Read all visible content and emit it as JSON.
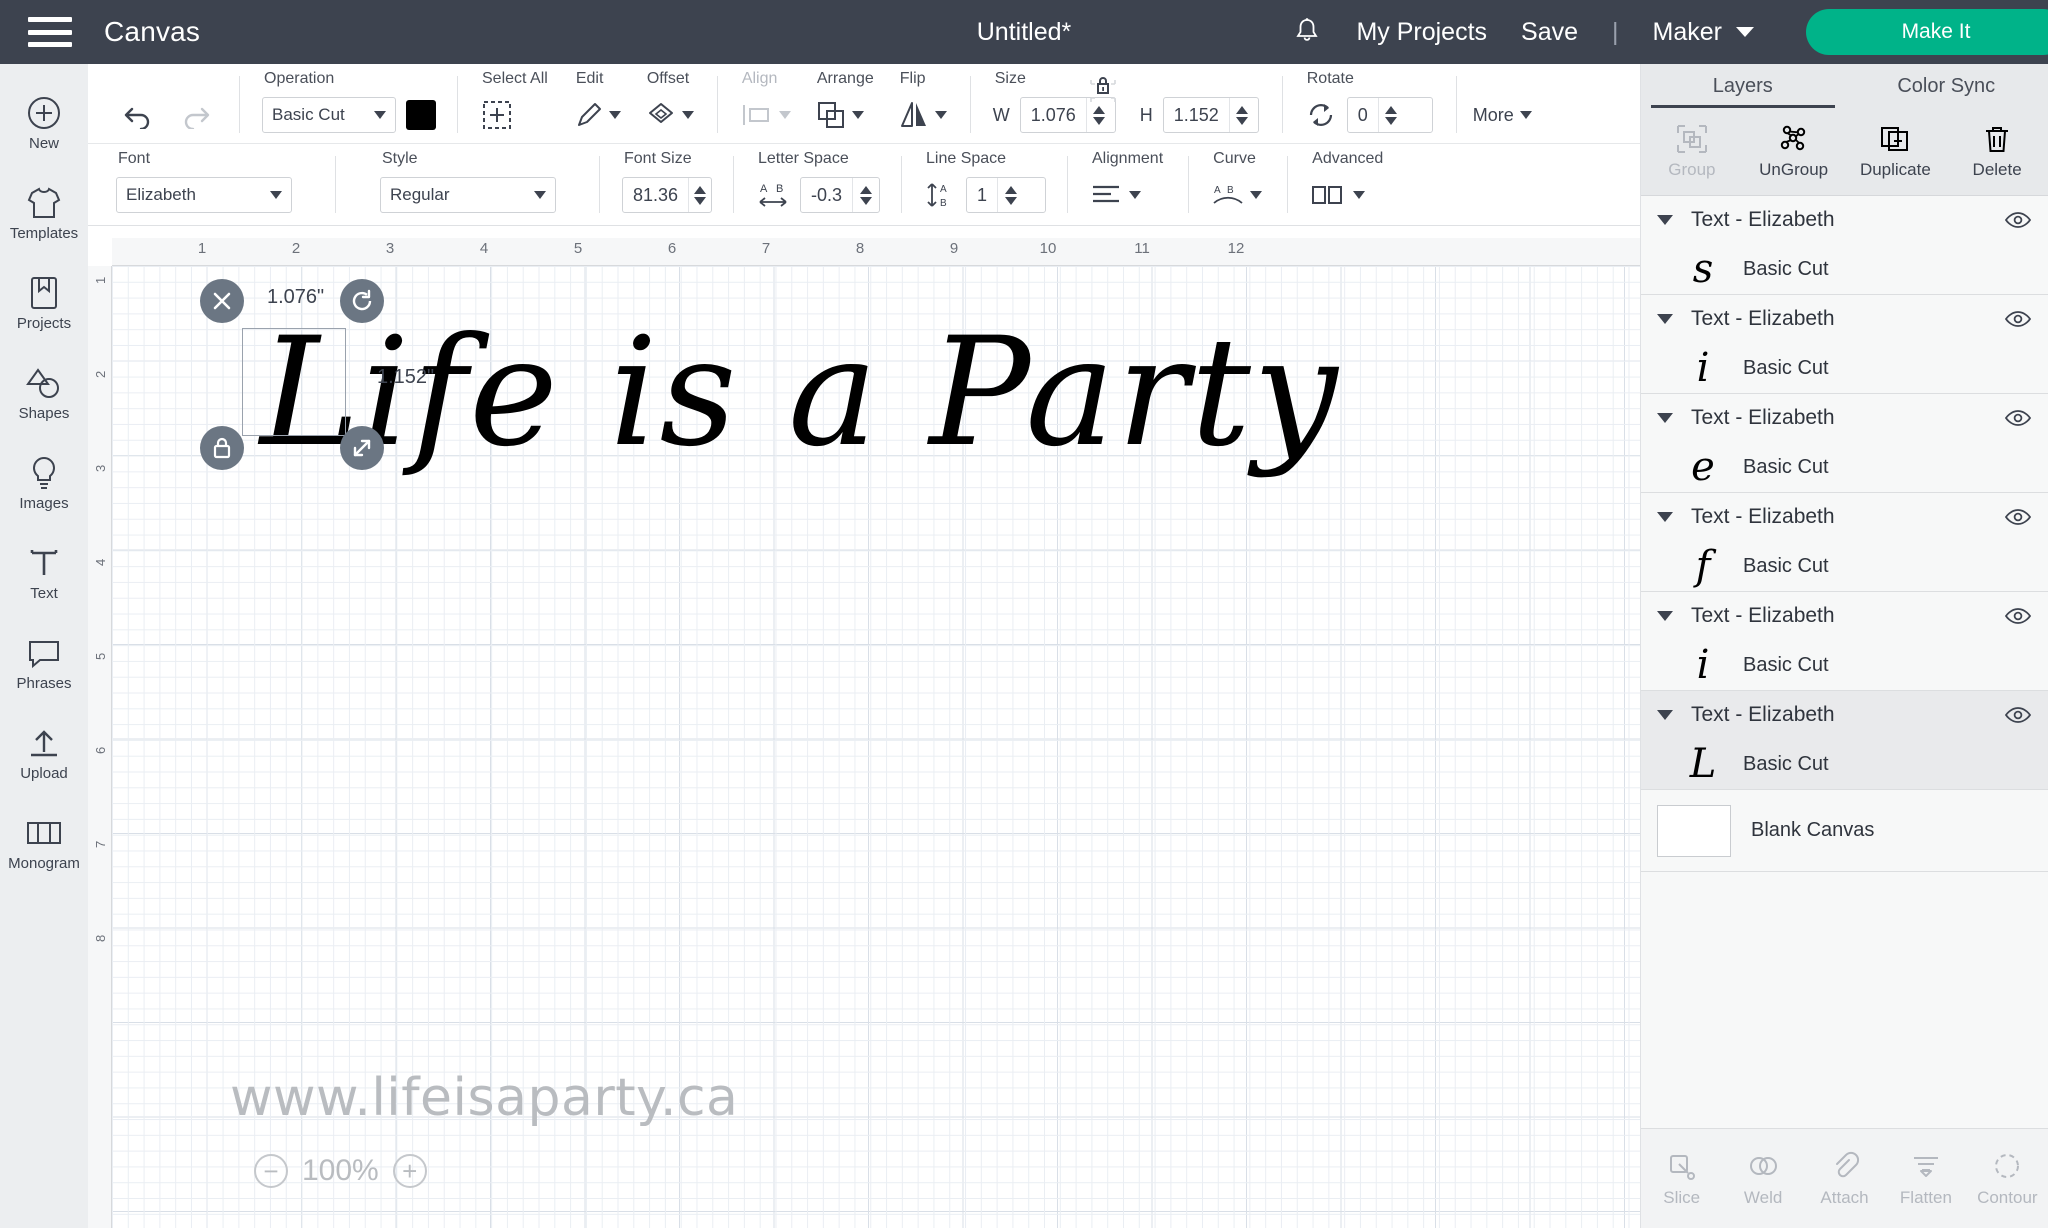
{
  "topbar": {
    "menu_icon": "hamburger-icon",
    "canvas_label": "Canvas",
    "title": "Untitled*",
    "bell_icon": "notification-bell-icon",
    "my_projects": "My Projects",
    "save": "Save",
    "separator": "|",
    "machine": "Maker",
    "make_it": "Make It",
    "accent_green": "#00b389",
    "bar_bg": "#3d434f"
  },
  "left_rail": [
    {
      "label": "New",
      "icon": "plus-circle-icon"
    },
    {
      "label": "Templates",
      "icon": "tshirt-icon"
    },
    {
      "label": "Projects",
      "icon": "projects-icon"
    },
    {
      "label": "Shapes",
      "icon": "shapes-icon"
    },
    {
      "label": "Images",
      "icon": "lightbulb-image-icon"
    },
    {
      "label": "Text",
      "icon": "text-T-icon"
    },
    {
      "label": "Phrases",
      "icon": "speech-bubble-icon"
    },
    {
      "label": "Upload",
      "icon": "upload-arrow-icon"
    },
    {
      "label": "Monogram",
      "icon": "monogram-icon"
    }
  ],
  "toolbar": {
    "undo_icon": "undo-arrow-icon",
    "redo_icon": "redo-arrow-icon",
    "operation": {
      "label": "Operation",
      "value": "Basic Cut",
      "color": "#000000"
    },
    "select_all": {
      "label": "Select All",
      "icon": "select-all-icon"
    },
    "edit": {
      "label": "Edit",
      "icon": "pencil-icon"
    },
    "offset": {
      "label": "Offset",
      "icon": "offset-icon"
    },
    "align": {
      "label": "Align",
      "icon": "align-icon",
      "disabled": true
    },
    "arrange": {
      "label": "Arrange",
      "icon": "arrange-icon"
    },
    "flip": {
      "label": "Flip",
      "icon": "flip-icon"
    },
    "size": {
      "label": "Size",
      "w_label": "W",
      "w_value": "1.076",
      "h_label": "H",
      "h_value": "1.152",
      "lock_icon": "lock-closed-icon"
    },
    "rotate": {
      "label": "Rotate",
      "value": "0",
      "icon": "rotate-icon"
    },
    "more": {
      "label": "More"
    }
  },
  "text_toolbar": {
    "font": {
      "label": "Font",
      "value": "Elizabeth"
    },
    "style": {
      "label": "Style",
      "value": "Regular"
    },
    "font_size": {
      "label": "Font Size",
      "value": "81.36"
    },
    "letter_space": {
      "label": "Letter Space",
      "value": "-0.3",
      "icon": "letter-space-icon"
    },
    "line_space": {
      "label": "Line Space",
      "value": "1",
      "icon": "line-space-icon"
    },
    "alignment": {
      "label": "Alignment",
      "icon": "align-left-icon"
    },
    "curve": {
      "label": "Curve",
      "icon": "curve-text-icon"
    },
    "advanced": {
      "label": "Advanced",
      "icon": "advanced-icon"
    }
  },
  "canvas": {
    "artwork_text": "Life is a Party",
    "ruler_h_ticks": [
      "1",
      "2",
      "3",
      "4",
      "5",
      "6",
      "7",
      "8",
      "9",
      "10",
      "11",
      "12"
    ],
    "ruler_v_ticks": [
      "1",
      "2",
      "3",
      "4",
      "5",
      "6",
      "7",
      "8"
    ],
    "width_label": "1.076\"",
    "height_label": "1.152\"",
    "delete_handle_icon": "close-x-icon",
    "rotate_handle_icon": "rotate-handle-icon",
    "lock_handle_icon": "lock-handle-icon",
    "resize_handle_icon": "resize-diagonal-icon",
    "watermark": "www.lifeisaparty.ca",
    "zoom_value": "100%",
    "zoom_out_icon": "minus-circle-icon",
    "zoom_in_icon": "plus-circle-icon"
  },
  "right_panel": {
    "tabs": [
      {
        "label": "Layers",
        "active": true
      },
      {
        "label": "Color Sync",
        "active": false
      }
    ],
    "actions": [
      {
        "label": "Group",
        "icon": "group-icon",
        "disabled": true
      },
      {
        "label": "UnGroup",
        "icon": "ungroup-icon",
        "disabled": false
      },
      {
        "label": "Duplicate",
        "icon": "duplicate-icon",
        "disabled": false
      },
      {
        "label": "Delete",
        "icon": "trash-icon",
        "disabled": false
      }
    ],
    "layers": [
      {
        "title": "Text - Elizabeth",
        "glyph": "s",
        "operation": "Basic Cut",
        "selected": false
      },
      {
        "title": "Text - Elizabeth",
        "glyph": "i",
        "operation": "Basic Cut",
        "selected": false
      },
      {
        "title": "Text - Elizabeth",
        "glyph": "e",
        "operation": "Basic Cut",
        "selected": false
      },
      {
        "title": "Text - Elizabeth",
        "glyph": "f",
        "operation": "Basic Cut",
        "selected": false
      },
      {
        "title": "Text - Elizabeth",
        "glyph": "i",
        "operation": "Basic Cut",
        "selected": false
      },
      {
        "title": "Text - Elizabeth",
        "glyph": "L",
        "operation": "Basic Cut",
        "selected": true
      }
    ],
    "blank_canvas_label": "Blank Canvas",
    "bottom_actions": [
      {
        "label": "Slice",
        "icon": "slice-icon"
      },
      {
        "label": "Weld",
        "icon": "weld-icon"
      },
      {
        "label": "Attach",
        "icon": "attach-icon"
      },
      {
        "label": "Flatten",
        "icon": "flatten-icon"
      },
      {
        "label": "Contour",
        "icon": "contour-icon"
      }
    ]
  }
}
